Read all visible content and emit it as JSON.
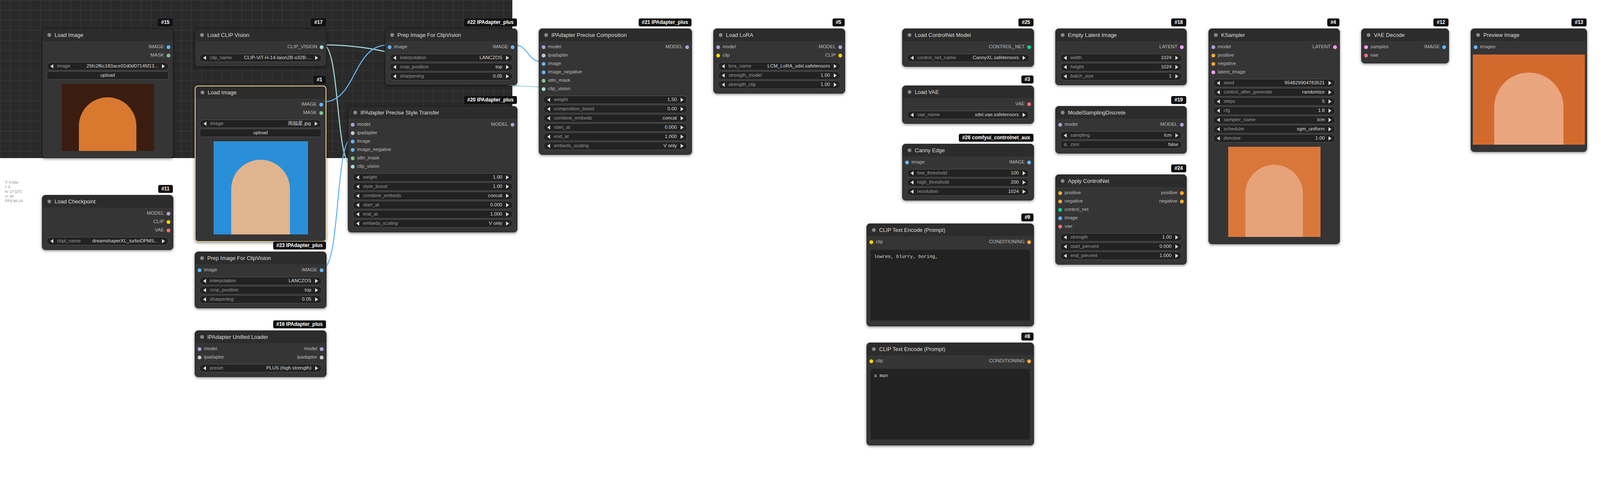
{
  "stats": [
    "T: 0.00s",
    "I: 0",
    "N: 27 [27]",
    "V: 40",
    "FPS:60.24"
  ],
  "nodes": [
    {
      "badge": "#15",
      "title": "Load Image",
      "selected": false,
      "inputs": [],
      "outputs": [
        "IMAGE",
        "MASK"
      ],
      "widgets": [
        {
          "kind": "combo",
          "label": "image",
          "value": "25fc2f6c183ace02d0d07145f13..."
        },
        {
          "kind": "button",
          "label": "upload"
        }
      ],
      "preview": {
        "background": "#3a1d10",
        "subject": "#d8792f"
      }
    },
    {
      "badge": "#17",
      "title": "Load CLIP Vision",
      "selected": false,
      "inputs": [],
      "outputs": [
        "CLIP_VISION"
      ],
      "widgets": [
        {
          "kind": "combo",
          "label": "clip_name",
          "value": "CLIP-ViT-H-14-laion2B-s32B-..."
        }
      ]
    },
    {
      "badge": "#22 IPAdapter_plus",
      "title": "Prep Image For ClipVision",
      "selected": false,
      "inputs": [
        "image"
      ],
      "outputs": [
        "IMAGE"
      ],
      "widgets": [
        {
          "kind": "combo",
          "label": "interpolation",
          "value": "LANCZOS"
        },
        {
          "kind": "combo",
          "label": "crop_position",
          "value": "top"
        },
        {
          "kind": "number",
          "label": "sharpening",
          "value": "0.05"
        }
      ]
    },
    {
      "badge": "#21 IPAdapter_plus",
      "title": "IPAdapter Precise Composition",
      "selected": false,
      "inputs": [
        "model",
        "ipadapter",
        "image",
        "image_negative",
        "attn_mask",
        "clip_vision"
      ],
      "outputs": [
        "MODEL"
      ],
      "widgets": [
        {
          "kind": "number",
          "label": "weight",
          "value": "1.50"
        },
        {
          "kind": "number",
          "label": "composition_boost",
          "value": "0.00"
        },
        {
          "kind": "combo",
          "label": "combine_embeds",
          "value": "concat"
        },
        {
          "kind": "number",
          "label": "start_at",
          "value": "0.000"
        },
        {
          "kind": "number",
          "label": "end_at",
          "value": "1.000"
        },
        {
          "kind": "combo",
          "label": "embeds_scaling",
          "value": "V only"
        }
      ]
    },
    {
      "badge": "#5",
      "title": "Load LoRA",
      "selected": false,
      "inputs": [
        "model",
        "clip"
      ],
      "outputs": [
        "MODEL",
        "CLIP"
      ],
      "widgets": [
        {
          "kind": "combo",
          "label": "lora_name",
          "value": "LCM_LoRA_sdxl.safetensors"
        },
        {
          "kind": "number",
          "label": "strength_model",
          "value": "1.00"
        },
        {
          "kind": "number",
          "label": "strength_clip",
          "value": "1.00"
        }
      ]
    },
    {
      "badge": "#25",
      "title": "Load ControlNet Model",
      "selected": false,
      "inputs": [],
      "outputs": [
        "CONTROL_NET"
      ],
      "widgets": [
        {
          "kind": "combo",
          "label": "control_net_name",
          "value": "CannyXL.safetensors"
        }
      ]
    },
    {
      "badge": "#18",
      "title": "Empty Latent Image",
      "selected": false,
      "inputs": [],
      "outputs": [
        "LATENT"
      ],
      "widgets": [
        {
          "kind": "number",
          "label": "width",
          "value": "1024"
        },
        {
          "kind": "number",
          "label": "height",
          "value": "1024"
        },
        {
          "kind": "number",
          "label": "batch_size",
          "value": "1"
        }
      ]
    },
    {
      "badge": "#4",
      "title": "KSampler",
      "selected": false,
      "inputs": [
        "model",
        "positive",
        "negative",
        "latent_image"
      ],
      "outputs": [
        "LATENT"
      ],
      "widgets": [
        {
          "kind": "number",
          "label": "seed",
          "value": "954829904783521"
        },
        {
          "kind": "combo",
          "label": "control_after_generate",
          "value": "randomize"
        },
        {
          "kind": "number",
          "label": "steps",
          "value": "5"
        },
        {
          "kind": "number",
          "label": "cfg",
          "value": "1.8"
        },
        {
          "kind": "combo",
          "label": "sampler_name",
          "value": "lcm"
        },
        {
          "kind": "combo",
          "label": "scheduler",
          "value": "sgm_uniform"
        },
        {
          "kind": "number",
          "label": "denoise",
          "value": "1.00"
        }
      ],
      "preview": {
        "background": "#d9773a",
        "subject": "#e8a27a"
      }
    },
    {
      "badge": "#12",
      "title": "VAE Decode",
      "selected": false,
      "inputs": [
        "samples",
        "vae"
      ],
      "outputs": [
        "IMAGE"
      ],
      "widgets": []
    },
    {
      "badge": "#13",
      "title": "Preview Image",
      "selected": false,
      "inputs": [
        "images"
      ],
      "outputs": [],
      "widgets": [],
      "preview": {
        "background": "#d26a2e",
        "subject": "#e9a57e"
      }
    },
    {
      "badge": "#1",
      "title": "Load Image",
      "selected": true,
      "inputs": [],
      "outputs": [
        "IMAGE",
        "MASK"
      ],
      "widgets": [
        {
          "kind": "combo",
          "label": "image",
          "value": "周福星.jpg"
        },
        {
          "kind": "button",
          "label": "upload"
        }
      ],
      "preview": {
        "background": "#2a8fd8",
        "subject": "#e0b48f"
      }
    },
    {
      "badge": "#20 IPAdapter_plus",
      "title": "IPAdapter Precise Style Transfer",
      "selected": false,
      "inputs": [
        "model",
        "ipadapter",
        "image",
        "image_negative",
        "attn_mask",
        "clip_vision"
      ],
      "outputs": [
        "MODEL"
      ],
      "widgets": [
        {
          "kind": "number",
          "label": "weight",
          "value": "1.00"
        },
        {
          "kind": "number",
          "label": "style_boost",
          "value": "1.00"
        },
        {
          "kind": "combo",
          "label": "combine_embeds",
          "value": "concat"
        },
        {
          "kind": "number",
          "label": "start_at",
          "value": "0.000"
        },
        {
          "kind": "number",
          "label": "end_at",
          "value": "1.000"
        },
        {
          "kind": "combo",
          "label": "embeds_scaling",
          "value": "V only"
        }
      ]
    },
    {
      "badge": "#11",
      "title": "Load Checkpoint",
      "selected": false,
      "inputs": [],
      "outputs": [
        "MODEL",
        "CLIP",
        "VAE"
      ],
      "widgets": [
        {
          "kind": "combo",
          "label": "ckpt_name",
          "value": "dreamshaperXL_turboDPMS..."
        }
      ]
    },
    {
      "badge": "#23 IPAdapter_plus",
      "title": "Prep Image For ClipVision",
      "selected": false,
      "inputs": [
        "image"
      ],
      "outputs": [
        "IMAGE"
      ],
      "widgets": [
        {
          "kind": "combo",
          "label": "interpolation",
          "value": "LANCZOS"
        },
        {
          "kind": "combo",
          "label": "crop_position",
          "value": "top"
        },
        {
          "kind": "number",
          "label": "sharpening",
          "value": "0.05"
        }
      ]
    },
    {
      "badge": "#16 IPAdapter_plus",
      "title": "IPAdapter Unified Loader",
      "selected": false,
      "inputs": [
        "model",
        "ipadapter"
      ],
      "outputs": [
        "model",
        "ipadapter"
      ],
      "widgets": [
        {
          "kind": "combo",
          "label": "preset",
          "value": "PLUS (high strength)"
        }
      ]
    },
    {
      "badge": "#3",
      "title": "Load VAE",
      "selected": false,
      "inputs": [],
      "outputs": [
        "VAE"
      ],
      "widgets": [
        {
          "kind": "combo",
          "label": "vae_name",
          "value": "sdxl.vae.safetensors"
        }
      ]
    },
    {
      "badge": "#26 comfyui_controlnet_aux",
      "title": "Canny Edge",
      "selected": false,
      "inputs": [
        "image"
      ],
      "outputs": [
        "IMAGE"
      ],
      "widgets": [
        {
          "kind": "number",
          "label": "low_threshold",
          "value": "100"
        },
        {
          "kind": "number",
          "label": "high_threshold",
          "value": "200"
        },
        {
          "kind": "number",
          "label": "resolution",
          "value": "1024"
        }
      ]
    },
    {
      "badge": "#19",
      "title": "ModelSamplingDiscrete",
      "selected": false,
      "inputs": [
        "model"
      ],
      "outputs": [
        "MODEL"
      ],
      "widgets": [
        {
          "kind": "combo",
          "label": "sampling",
          "value": "lcm"
        },
        {
          "kind": "toggle",
          "label": "zsnr",
          "value": "false",
          "on": false
        }
      ]
    },
    {
      "badge": "#24",
      "title": "Apply ControlNet",
      "selected": false,
      "inputs": [
        "positive",
        "negative",
        "control_net",
        "image",
        "vae"
      ],
      "outputs": [
        "positive",
        "negative"
      ],
      "widgets": [
        {
          "kind": "number",
          "label": "strength",
          "value": "1.00"
        },
        {
          "kind": "number",
          "label": "start_percent",
          "value": "0.000"
        },
        {
          "kind": "number",
          "label": "end_percent",
          "value": "1.000"
        }
      ]
    },
    {
      "badge": "#9",
      "title": "CLIP Text Encode (Prompt)",
      "selected": false,
      "inputs": [
        "clip"
      ],
      "outputs": [
        "CONDITIONING"
      ],
      "widgets": [
        {
          "kind": "text",
          "label": "text",
          "value": "lowres, blurry, boring,"
        }
      ]
    },
    {
      "badge": "#8",
      "title": "CLIP Text Encode (Prompt)",
      "selected": false,
      "inputs": [
        "clip"
      ],
      "outputs": [
        "CONDITIONING"
      ],
      "widgets": [
        {
          "kind": "text",
          "label": "text",
          "value": "a man"
        }
      ]
    }
  ]
}
